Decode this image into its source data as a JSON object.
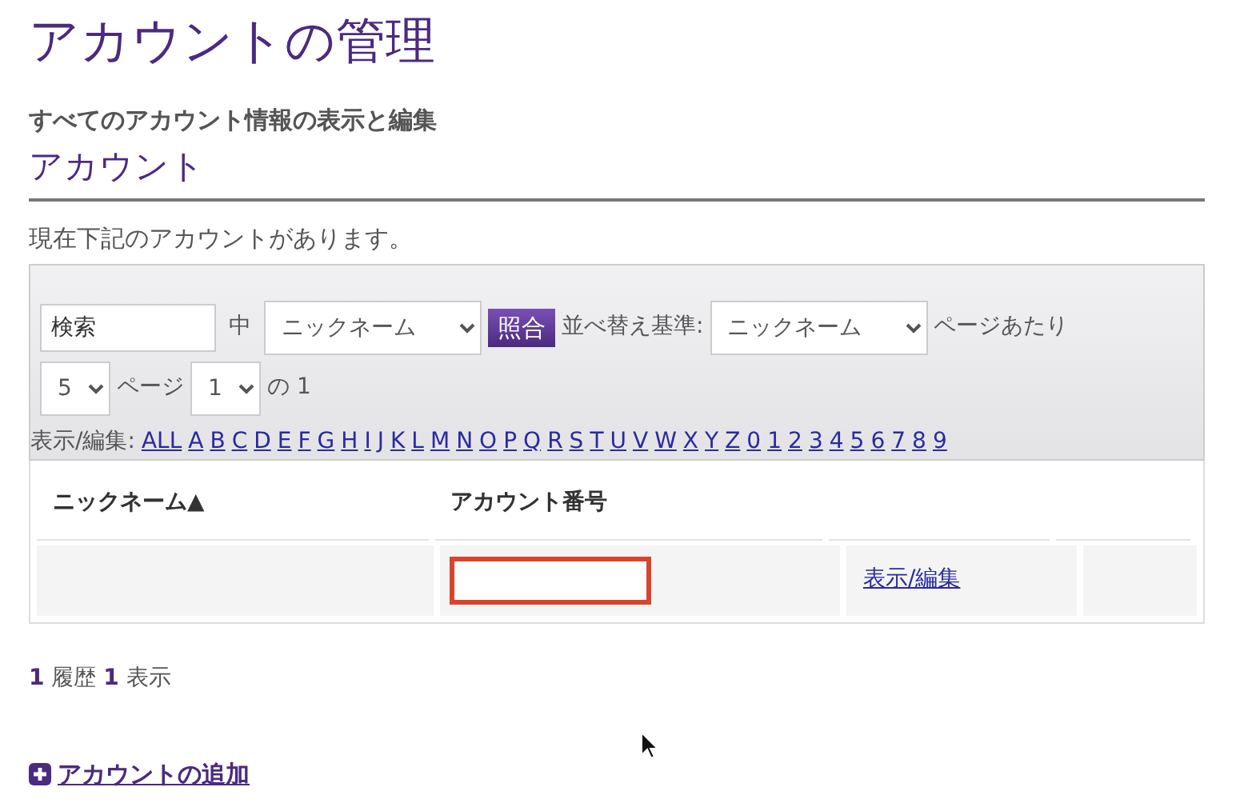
{
  "page_title": "アカウントの管理",
  "subtitle": "すべてのアカウント情報の表示と編集",
  "section_title": "アカウント",
  "intro": "現在下記のアカウントがあります。",
  "filter": {
    "search_value": "検索",
    "in_label": "中",
    "field_select": "ニックネーム",
    "match_button": "照合",
    "sort_label": "並べ替え基準:",
    "sort_select": "ニックネーム",
    "per_page_label": "ページあたり",
    "per_page_select": "5",
    "page_label": "ページ",
    "page_select": "1",
    "of_label": "の 1"
  },
  "letters_label": "表示/編集:",
  "letters": [
    "ALL",
    "A",
    "B",
    "C",
    "D",
    "E",
    "F",
    "G",
    "H",
    "I",
    "J",
    "K",
    "L",
    "M",
    "N",
    "O",
    "P",
    "Q",
    "R",
    "S",
    "T",
    "U",
    "V",
    "W",
    "X",
    "Y",
    "Z",
    "0",
    "1",
    "2",
    "3",
    "4",
    "5",
    "6",
    "7",
    "8",
    "9"
  ],
  "table": {
    "columns": [
      "ニックネーム▲",
      "アカウント番号"
    ],
    "rows": [
      {
        "account_field_highlighted": true,
        "link": "表示/編集"
      }
    ]
  },
  "summary": "**1** 履歴 **1** 表示",
  "add_link": "アカウントの追加"
}
